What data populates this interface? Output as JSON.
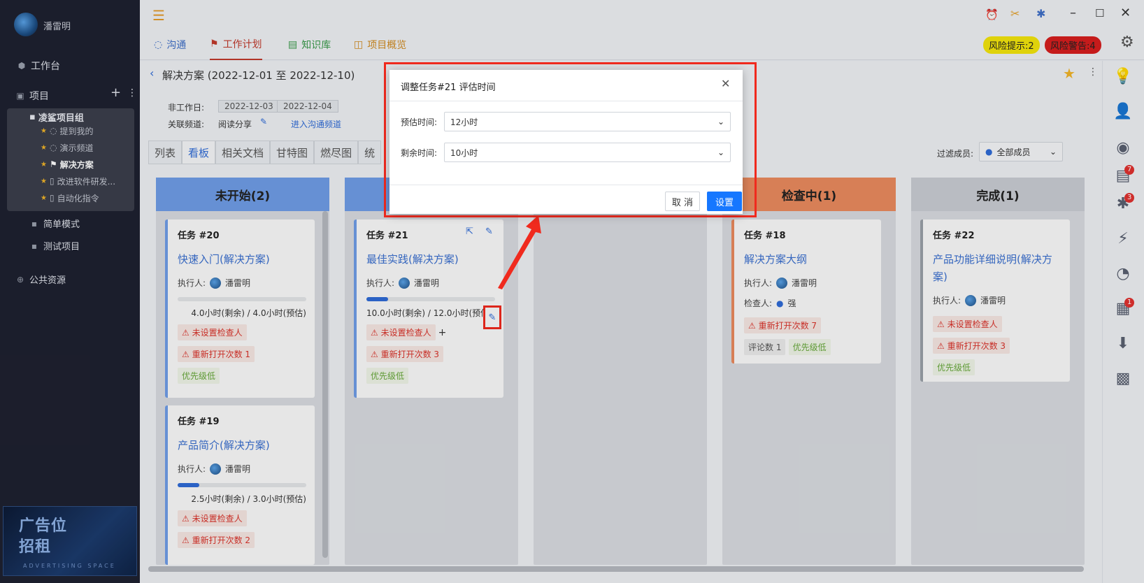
{
  "user": {
    "name": "潘雷明"
  },
  "nav": {
    "workbench": "工作台",
    "projects": "项目",
    "public": "公共资源"
  },
  "tree": {
    "group": "凌鲨项目组",
    "items": [
      "提到我的",
      "演示频道",
      "解决方案",
      "改进软件研发...",
      "自动化指令"
    ],
    "simple": "简单模式",
    "test": "测试项目"
  },
  "ad": {
    "line1": "广告位",
    "line2": "招租",
    "line3": "ADVERTISING SPACE"
  },
  "tabs": [
    "沟通",
    "工作计划",
    "知识库",
    "项目概览"
  ],
  "risk": {
    "hint": "风险提示:2",
    "warn": "风险警告:4"
  },
  "header": {
    "title": "解决方案 (2022-12-01 至 2022-12-10)",
    "nonwork_label": "非工作日:",
    "dates": [
      "2022-12-03",
      "2022-12-04"
    ],
    "channel_label": "关联频道:",
    "channel": "阅读分享",
    "enter_channel": "进入沟通频道"
  },
  "viewtabs": [
    "列表",
    "看板",
    "相关文档",
    "甘特图",
    "燃尽图",
    "统"
  ],
  "filter": {
    "label": "过滤成员:",
    "value": "全部成员"
  },
  "columns": [
    {
      "title": "未开始(2)",
      "color": "#6f9de6"
    },
    {
      "title": "",
      "color": "#6f9de6"
    },
    {
      "title": "",
      "color": "#d8dbe0"
    },
    {
      "title": "检查中(1)",
      "color": "#ea8a5e"
    },
    {
      "title": "完成(1)",
      "color": "#c9cdd3"
    }
  ],
  "cards": {
    "c20": {
      "id": "任务 #20",
      "title": "快速入门(解决方案)",
      "assignee_label": "执行人:",
      "assignee": "潘雷明",
      "time": "4.0小时(剩余) / 4.0小时(预估)",
      "progress": 0.0,
      "tags": [
        "⚠ 未设置检查人",
        "⚠ 重新打开次数 1",
        "优先级低"
      ]
    },
    "c19": {
      "id": "任务 #19",
      "title": "产品简介(解决方案)",
      "assignee_label": "执行人:",
      "assignee": "潘雷明",
      "time": "2.5小时(剩余) / 3.0小时(预估)",
      "progress": 0.17,
      "tags": [
        "⚠ 未设置检查人",
        "⚠ 重新打开次数 2"
      ]
    },
    "c21": {
      "id": "任务 #21",
      "title": "最佳实践(解决方案)",
      "assignee_label": "执行人:",
      "assignee": "潘雷明",
      "time": "10.0小时(剩余) / 12.0小时(预估)",
      "progress": 0.17,
      "tags": [
        "⚠ 未设置检查人",
        "⚠ 重新打开次数 3",
        "优先级低"
      ]
    },
    "c18": {
      "id": "任务 #18",
      "title": "解决方案大纲",
      "assignee_label": "执行人:",
      "assignee": "潘雷明",
      "checker_label": "检查人:",
      "checker": "强",
      "tags": [
        "⚠ 重新打开次数 7",
        "评论数 1",
        "优先级低"
      ]
    },
    "c22": {
      "id": "任务 #22",
      "title": "产品功能详细说明(解决方案)",
      "assignee_label": "执行人:",
      "assignee": "潘雷明",
      "tags": [
        "⚠ 未设置检查人",
        "⚠ 重新打开次数 3",
        "优先级低"
      ]
    }
  },
  "dialog": {
    "title": "调整任务#21 评估时间",
    "est_label": "预估时间:",
    "est_value": "12小时",
    "rem_label": "剩余时间:",
    "rem_value": "10小时",
    "cancel": "取 消",
    "ok": "设置"
  },
  "rightbar": {
    "badges": [
      "7",
      "3",
      "1"
    ]
  },
  "colors": {
    "accent": "#2f6bd6",
    "highlight": "#f02a1e"
  }
}
